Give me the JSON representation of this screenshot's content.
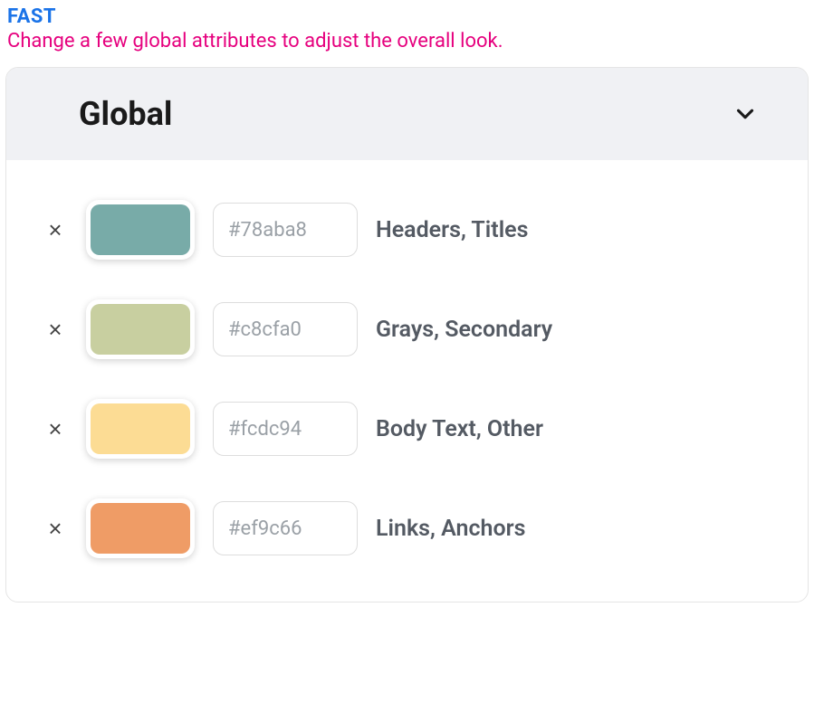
{
  "header": {
    "tag": "FAST",
    "subtitle": "Change a few global attributes to adjust the overall look."
  },
  "panel": {
    "title": "Global",
    "rows": [
      {
        "hex": "#78aba8",
        "label": "Headers, Titles",
        "swatch": "#78aba8"
      },
      {
        "hex": "#c8cfa0",
        "label": "Grays, Secondary",
        "swatch": "#c8cfa0"
      },
      {
        "hex": "#fcdc94",
        "label": "Body Text, Other",
        "swatch": "#fcdc94"
      },
      {
        "hex": "#ef9c66",
        "label": "Links, Anchors",
        "swatch": "#ef9c66"
      }
    ]
  },
  "icons": {
    "remove": "×"
  }
}
